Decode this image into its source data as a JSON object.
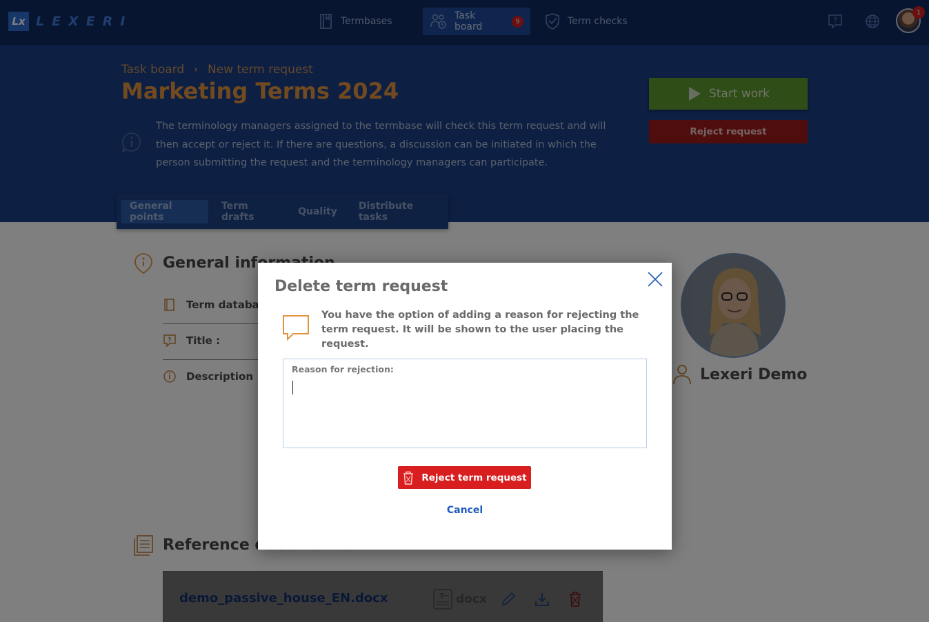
{
  "app": {
    "logo_mark": "Lx",
    "logo_text": "LEXERI"
  },
  "nav": {
    "items": [
      {
        "label": "Termbases",
        "icon": "book-icon"
      },
      {
        "label": "Task board",
        "icon": "people-icon",
        "badge": "9"
      },
      {
        "label": "Term checks",
        "icon": "shield-check-icon"
      }
    ],
    "notification_count": "1"
  },
  "breadcrumb": {
    "parent": "Task board",
    "current": "New term request"
  },
  "page": {
    "title": "Marketing Terms 2024",
    "info": "The terminology managers assigned to the termbase will check this term request and will then accept or reject it. If there are questions, a discussion can be initiated in which the person submitting the request and the terminology managers can participate."
  },
  "actions": {
    "start_work": "Start work",
    "reject_request": "Reject request"
  },
  "tabs": [
    "General points",
    "Term drafts",
    "Quality",
    "Distribute tasks"
  ],
  "general_info": {
    "heading": "General information",
    "fields": {
      "term_database": "Term database :",
      "title": "Title :",
      "description": "Description :"
    }
  },
  "user": {
    "name": "Lexeri Demo"
  },
  "reference_docs": {
    "heading": "Reference documents",
    "file_name": "demo_passive_house_EN.docx",
    "file_type": "docx"
  },
  "modal": {
    "title": "Delete term request",
    "message": "You have the option of adding a reason for rejecting the term request. It will be shown to the user placing the request.",
    "reason_label": "Reason for rejection:",
    "reason_value": "",
    "confirm_label": "Reject term request",
    "cancel_label": "Cancel"
  },
  "colors": {
    "nav_bg": "#102a63",
    "header_bg": "#1a3e86",
    "title_orange": "#e39440",
    "start_green": "#5e9a2e",
    "reject_red": "#d81e1e",
    "link_blue": "#1d5bbd"
  }
}
